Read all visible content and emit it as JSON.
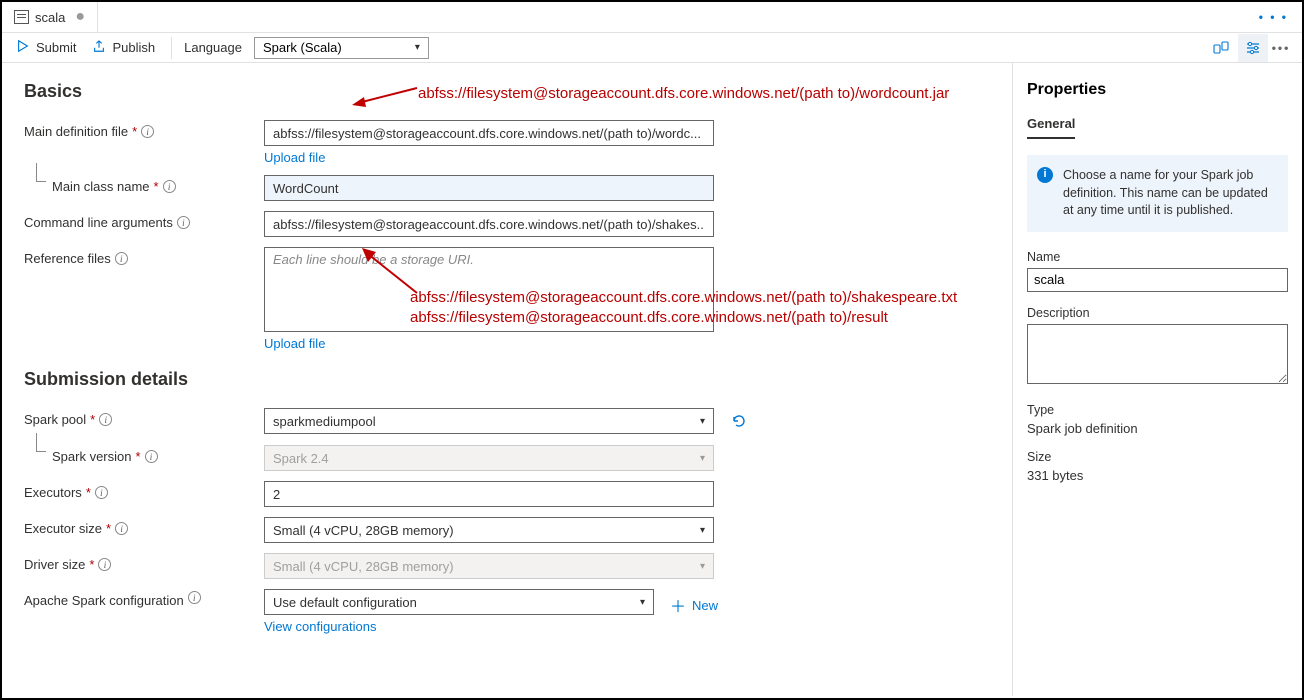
{
  "tab": {
    "title": "scala"
  },
  "toolbar": {
    "submit": "Submit",
    "publish": "Publish",
    "language_label": "Language",
    "language_value": "Spark (Scala)"
  },
  "sections": {
    "basics": "Basics",
    "submission": "Submission details"
  },
  "labels": {
    "main_def": "Main definition file",
    "main_class": "Main class name",
    "cli_args": "Command line arguments",
    "ref_files": "Reference files",
    "spark_pool": "Spark pool",
    "spark_version": "Spark version",
    "executors": "Executors",
    "executor_size": "Executor size",
    "driver_size": "Driver size",
    "spark_config": "Apache Spark configuration"
  },
  "values": {
    "main_def": "abfss://filesystem@storageaccount.dfs.core.windows.net/(path to)/wordc...",
    "upload_file": "Upload file",
    "main_class": "WordCount",
    "cli_args": "abfss://filesystem@storageaccount.dfs.core.windows.net/(path to)/shakes...",
    "ref_placeholder": "Each line should be a storage URI.",
    "spark_pool": "sparkmediumpool",
    "spark_version": "Spark 2.4",
    "executors": "2",
    "executor_size": "Small (4 vCPU, 28GB memory)",
    "driver_size": "Small (4 vCPU, 28GB memory)",
    "spark_config": "Use default configuration",
    "new": "New",
    "view_configs": "View configurations"
  },
  "annotations": {
    "def_full": "abfss://filesystem@storageaccount.dfs.core.windows.net/(path to)/wordcount.jar",
    "shakespeare": "abfss://filesystem@storageaccount.dfs.core.windows.net/(path to)/shakespeare.txt",
    "result": "abfss://filesystem@storageaccount.dfs.core.windows.net/(path to)/result"
  },
  "properties": {
    "title": "Properties",
    "tab_general": "General",
    "info": "Choose a name for your Spark job definition. This name can be updated at any time until it is published.",
    "name_label": "Name",
    "name_value": "scala",
    "desc_label": "Description",
    "type_label": "Type",
    "type_value": "Spark job definition",
    "size_label": "Size",
    "size_value": "331 bytes"
  }
}
